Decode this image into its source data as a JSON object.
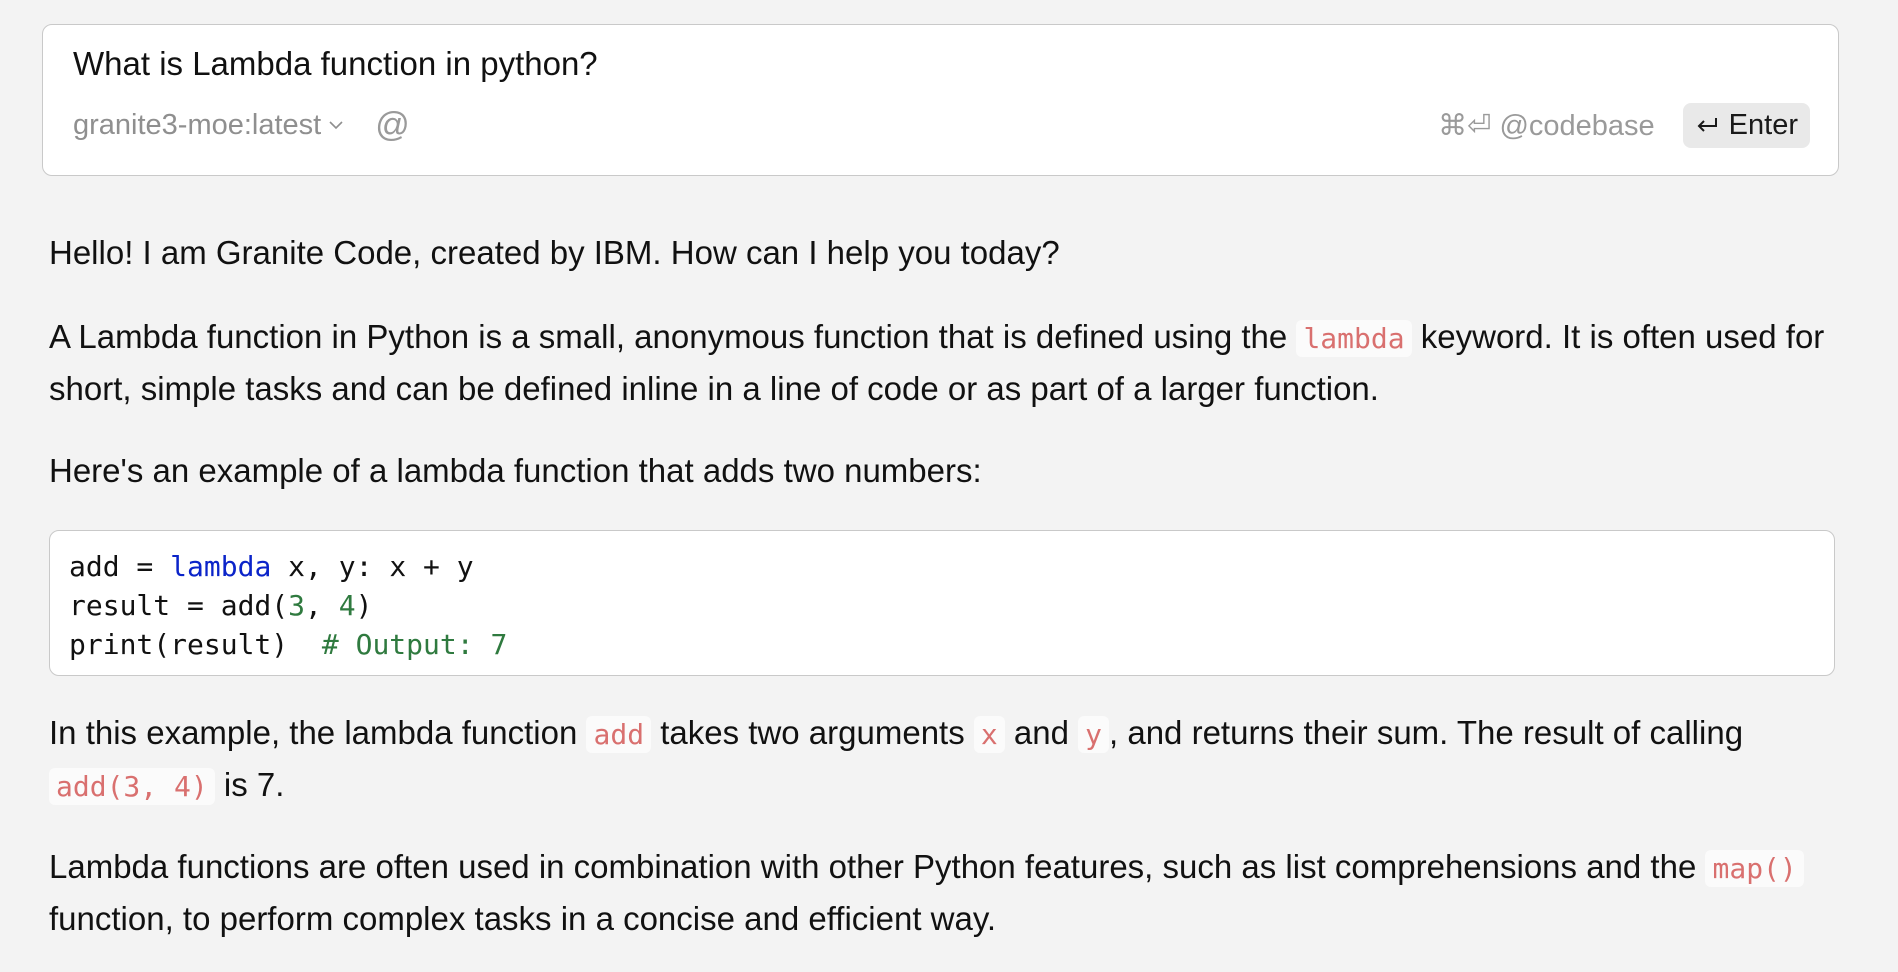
{
  "input": {
    "question": "What is Lambda function in python?",
    "model": "granite3-moe:latest",
    "codebase_shortcut": "⌘⏎ @codebase",
    "enter_label": "Enter"
  },
  "response": {
    "greeting": "Hello! I am Granite Code, created by IBM. How can I help you today?",
    "p2_a": "A Lambda function in Python is a small, anonymous function that is defined using the",
    "p2_code": "lambda",
    "p2_b": "keyword. It is often used for short, simple tasks and can be defined inline in a line of code or as part of a larger function.",
    "p3": "Here's an example of a lambda function that adds two numbers:",
    "code": {
      "l1_a": "add = ",
      "l1_kw": "lambda",
      "l1_b": " x, y: x + y",
      "l2_a": "result = add(",
      "l2_n1": "3",
      "l2_b": ", ",
      "l2_n2": "4",
      "l2_c": ")",
      "l3_a": "print(result)  ",
      "l3_cmt": "# Output: 7"
    },
    "p4_a": "In this example, the lambda function",
    "p4_code1": "add",
    "p4_b": "takes two arguments",
    "p4_code2": "x",
    "p4_c": "and",
    "p4_code3": "y",
    "p4_d": ", and returns their sum. The result of calling",
    "p4_code4": "add(3, 4)",
    "p4_e": "is 7.",
    "p5_a": "Lambda functions are often used in combination with other Python features, such as list comprehensions and the",
    "p5_code": "map()",
    "p5_b": "function, to perform complex tasks in a concise and efficient way."
  }
}
